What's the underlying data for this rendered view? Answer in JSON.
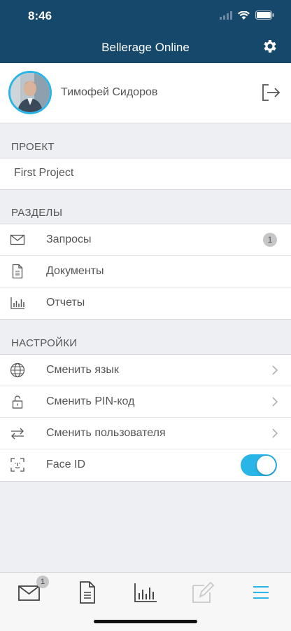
{
  "status_bar": {
    "time": "8:46"
  },
  "header": {
    "title": "Bellerage Online"
  },
  "profile": {
    "name": "Тимофей Сидоров"
  },
  "sections": {
    "project_header": "ПРОЕКТ",
    "project_name": "First Project",
    "sections_header": "РАЗДЕЛЫ",
    "requests_label": "Запросы",
    "requests_badge": "1",
    "documents_label": "Документы",
    "reports_label": "Отчеты",
    "settings_header": "НАСТРОЙКИ",
    "change_language": "Сменить язык",
    "change_pin": "Сменить PIN-код",
    "change_user": "Сменить пользователя",
    "face_id": "Face ID",
    "face_id_enabled": true
  },
  "tabbar": {
    "messages_badge": "1"
  },
  "colors": {
    "header_bg": "#15486b",
    "accent": "#29b5e8",
    "background": "#eeeff3"
  }
}
